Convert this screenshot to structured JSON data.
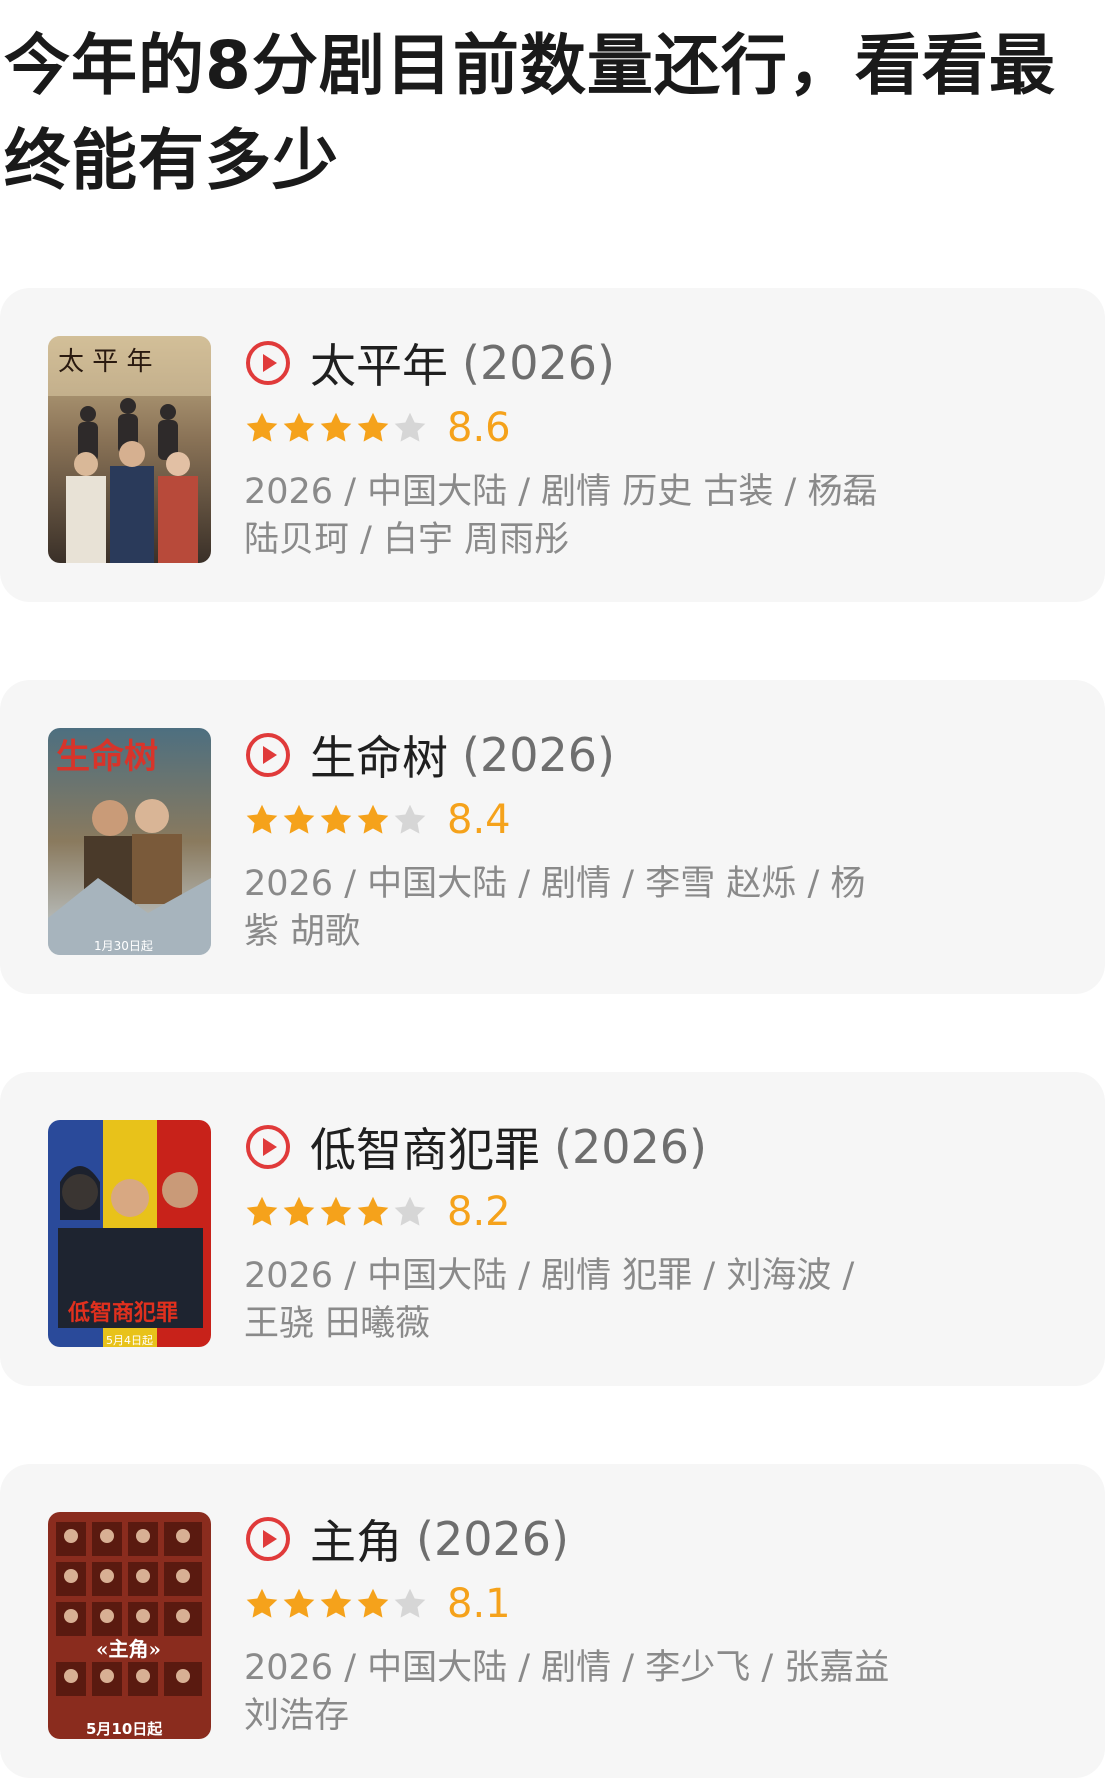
{
  "post": {
    "title": "今年的8分剧目前数量还行，看看最终能有多少"
  },
  "theme": {
    "star_filled": "#f5a21b",
    "star_empty": "#d6d6d6",
    "play_icon": "#e03a3a",
    "card_bg": "#f6f6f6"
  },
  "dramas": [
    {
      "name": "太平年",
      "year": "(2026)",
      "rating": "8.6",
      "stars_filled": 4,
      "meta": "2026 / 中国大陆 / 剧情 历史 古装 / 杨磊 陆贝珂 / 白宇 周雨彤",
      "poster_icon": "poster-image"
    },
    {
      "name": "生命树",
      "year": "(2026)",
      "rating": "8.4",
      "stars_filled": 4,
      "meta": "2026 / 中国大陆 / 剧情 / 李雪 赵烁 / 杨紫 胡歌",
      "poster_icon": "poster-image"
    },
    {
      "name": "低智商犯罪",
      "year": "(2026)",
      "rating": "8.2",
      "stars_filled": 4,
      "meta": "2026 / 中国大陆 / 剧情 犯罪 / 刘海波 / 王骁 田曦薇",
      "poster_icon": "poster-image"
    },
    {
      "name": "主角",
      "year": "(2026)",
      "rating": "8.1",
      "stars_filled": 4,
      "meta": "2026 / 中国大陆 / 剧情 / 李少飞 / 张嘉益 刘浩存",
      "poster_icon": "poster-image"
    }
  ]
}
